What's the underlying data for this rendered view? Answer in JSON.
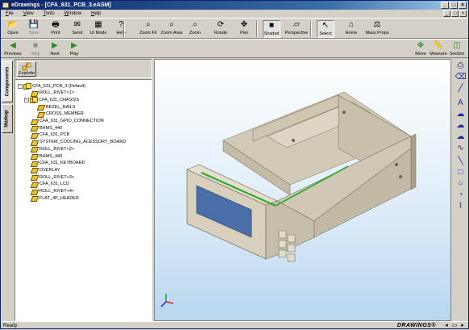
{
  "window": {
    "title": "eDrawings - [CFA_631_PCB_3.eASM]",
    "controls": [
      "_",
      "□",
      "×"
    ]
  },
  "menu": [
    "File",
    "View",
    "Tools",
    "Window",
    "Help"
  ],
  "mdi_controls": [
    "_",
    "□",
    "×"
  ],
  "toolbar1": [
    {
      "label": "Open",
      "icon": "open-folder-icon",
      "glyph": "📂"
    },
    {
      "label": "Save",
      "icon": "save-icon",
      "glyph": "💾",
      "disabled": true
    },
    {
      "label": "Print",
      "icon": "print-icon",
      "glyph": "🖶"
    },
    {
      "label": "Send",
      "icon": "send-icon",
      "glyph": "✉"
    },
    {
      "label": "UI Mode",
      "icon": "ui-mode-icon",
      "glyph": "▦"
    },
    {
      "label": "Help",
      "icon": "help-icon",
      "glyph": "?"
    },
    {
      "label": "Zoom Fit",
      "icon": "zoom-fit-icon",
      "glyph": "⌕"
    },
    {
      "label": "Zoom Area",
      "icon": "zoom-area-icon",
      "glyph": "⌕"
    },
    {
      "label": "Zoom",
      "icon": "zoom-icon",
      "glyph": "⌕"
    },
    {
      "label": "Rotate",
      "icon": "rotate-icon",
      "glyph": "⟳"
    },
    {
      "label": "Pan",
      "icon": "pan-icon",
      "glyph": "✥"
    },
    {
      "label": "Shaded",
      "icon": "shaded-icon",
      "glyph": "■",
      "pressed": true
    },
    {
      "label": "Perspective",
      "icon": "perspective-icon",
      "glyph": "▱"
    },
    {
      "label": "Select",
      "icon": "select-arrow-icon",
      "glyph": "↖",
      "pressed": true
    },
    {
      "label": "Home",
      "icon": "home-icon",
      "glyph": "⌂"
    },
    {
      "label": "Mass Props",
      "icon": "mass-props-icon",
      "glyph": "⚖"
    }
  ],
  "toolbar2": [
    {
      "label": "Previous",
      "icon": "previous-icon",
      "glyph": "◀"
    },
    {
      "label": "Stop",
      "icon": "stop-icon",
      "glyph": "■",
      "disabled": true
    },
    {
      "label": "Next",
      "icon": "next-icon",
      "glyph": "▶"
    },
    {
      "label": "Play",
      "icon": "play-icon",
      "glyph": "▶"
    },
    {
      "label": "Move",
      "icon": "move-icon",
      "glyph": "✥"
    },
    {
      "label": "Measure",
      "icon": "measure-icon",
      "glyph": "📏"
    },
    {
      "label": "Section",
      "icon": "section-icon",
      "glyph": "◫"
    }
  ],
  "side_tabs": [
    "Components",
    "Markup"
  ],
  "explode": {
    "label": "Explode"
  },
  "tree": [
    {
      "label": "CFA_631_PCB_3 (Default)",
      "level": 0,
      "expander": "−",
      "type": "asm"
    },
    {
      "label": "ROLL_RIVET<1>",
      "level": 1,
      "type": "prt"
    },
    {
      "label": "CFA_631_CHASSIS",
      "level": 1,
      "expander": "−",
      "type": "asm"
    },
    {
      "label": "BEZEL_RAILS",
      "level": 2,
      "type": "prt"
    },
    {
      "label": "CROSS_MEMBER",
      "level": 2,
      "type": "prt"
    },
    {
      "label": "CFA_631_GPIO_CONNECTION",
      "level": 1,
      "type": "prt"
    },
    {
      "label": "BHMS_440",
      "level": 1,
      "type": "prt"
    },
    {
      "label": "CFA_631_PCB",
      "level": 1,
      "type": "prt"
    },
    {
      "label": "SYSTEM_COOLING_ACESSORY_BOARD",
      "level": 1,
      "type": "prt"
    },
    {
      "label": "ROLL_RIVET<2>",
      "level": 1,
      "type": "prt"
    },
    {
      "label": "BHMS_440",
      "level": 1,
      "type": "prt"
    },
    {
      "label": "CFA_631_KEYBOARD",
      "level": 1,
      "type": "prt"
    },
    {
      "label": "OVERLAY",
      "level": 1,
      "type": "prt"
    },
    {
      "label": "ROLL_RIVET<3>",
      "level": 1,
      "type": "prt"
    },
    {
      "label": "CFA_631_LCD",
      "level": 1,
      "type": "prt"
    },
    {
      "label": "ROLL_RIVET<4>",
      "level": 1,
      "type": "prt"
    },
    {
      "label": "FLAT_4P_HEADER",
      "level": 1,
      "type": "prt"
    }
  ],
  "right_tools": [
    "stamp-icon",
    "eraser-icon",
    "line-icon",
    "text-icon",
    "cloud-icon",
    "cloud-text-icon",
    "cloud-icon",
    "freehand-icon",
    "line-icon",
    "rectangle-icon",
    "circle-icon",
    "arc-icon",
    "spline-icon"
  ],
  "status": {
    "text": "Ready",
    "brand": "DRAWINGS®"
  },
  "colors": {
    "titlebar": "#0a246a",
    "viewport_top": "#ffffff",
    "viewport_bottom": "#b8d6f0",
    "lcd_blue": "#4a6fa8",
    "pcb_green": "#2faa2f",
    "chassis": "#d8d0bc"
  }
}
